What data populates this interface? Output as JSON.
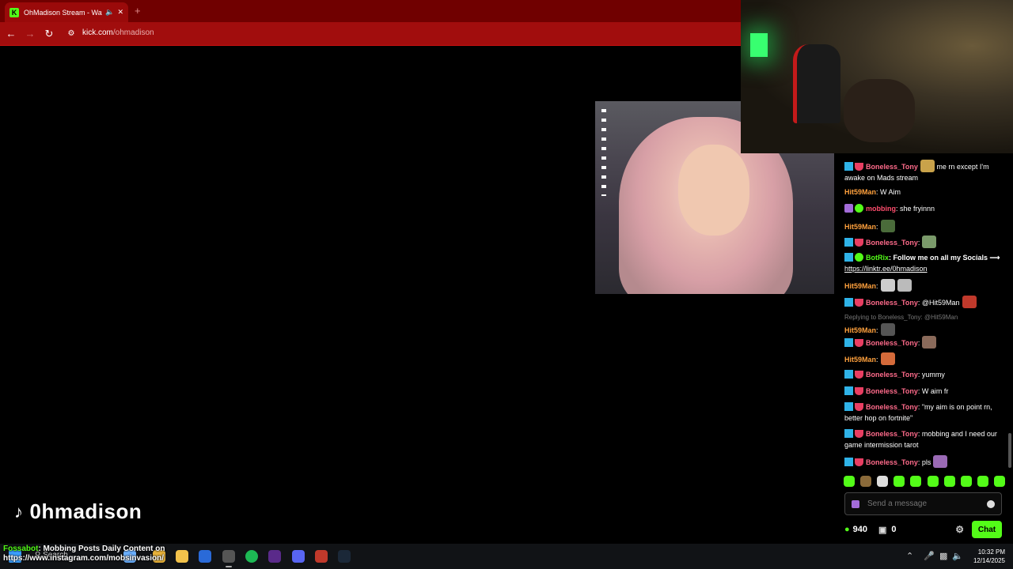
{
  "browser": {
    "tab_title": "OhMadison Stream - Watch",
    "tab_favicon": "K",
    "new_tab": "+",
    "url_host": "kick.com",
    "url_path": "/ohmadison"
  },
  "stream": {
    "tiktok_handle": "0hmadison"
  },
  "chat": {
    "messages": [
      {
        "user": "Boneless_Tony",
        "text": " me rn except I'm awake on Mads stream"
      },
      {
        "user": "Hit59Man",
        "text": ": W Aim"
      },
      {
        "user": "mobbing",
        "text": ": she fryinnn"
      },
      {
        "user": "Hit59Man",
        "text": ":"
      },
      {
        "user": "Boneless_Tony",
        "text": ":"
      },
      {
        "user": "BotRix",
        "text": ": Follow me on all my Socials ⟶",
        "link": "https://linktr.ee/0hmadison"
      },
      {
        "user": "Hit59Man",
        "text": ":"
      },
      {
        "user": "Boneless_Tony",
        "text": ": @Hit59Man"
      },
      {
        "reply": "Replying to Boneless_Tony: @Hit59Man",
        "user": "Hit59Man",
        "text": ":"
      },
      {
        "user": "Boneless_Tony",
        "text": ":"
      },
      {
        "user": "Hit59Man",
        "text": ":"
      },
      {
        "user": "Boneless_Tony",
        "text": ": yummy"
      },
      {
        "user": "Boneless_Tony",
        "text": ": W aim fr"
      },
      {
        "user": "Boneless_Tony",
        "text": ": \"my aim is on point rn, better hop on fortnite\""
      },
      {
        "user": "Boneless_Tony",
        "text": ": mobbing and I need our game intermission tarot"
      },
      {
        "user": "Boneless_Tony",
        "text": ": pls"
      }
    ],
    "input_placeholder": "Send a message",
    "points": "940",
    "gifts": "0",
    "send_label": "Chat"
  },
  "overlay": {
    "bot_name": "Fossabot",
    "bot_message": ": Mobbing Posts Daily Content on",
    "bot_link": "https://www.instagram.com/mobsinvasion/"
  },
  "taskbar": {
    "search_label": "Search",
    "time": "10:32 PM",
    "date": "12/14/2025"
  },
  "colors": {
    "kick_green": "#53fc18",
    "browser_red": "#a10d0d"
  }
}
